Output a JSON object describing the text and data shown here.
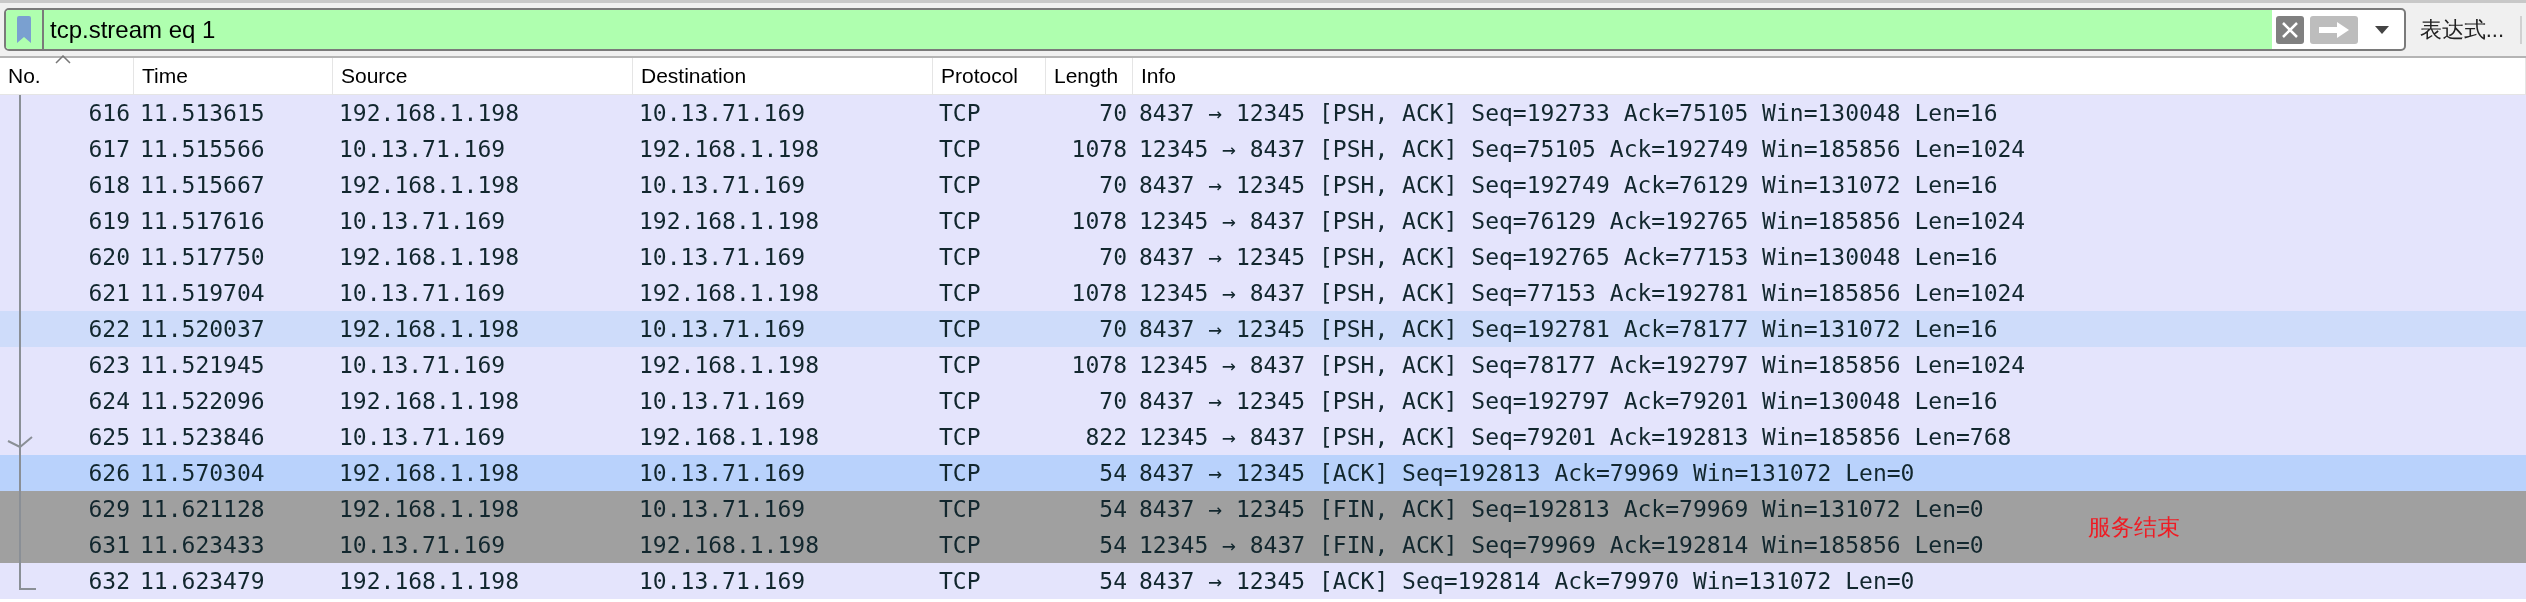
{
  "filter": {
    "value": "tcp.stream eq 1",
    "expression_button": "表达式..."
  },
  "table": {
    "columns": [
      {
        "label": "No.",
        "sorted": true
      },
      {
        "label": "Time",
        "sorted": false
      },
      {
        "label": "Source",
        "sorted": false
      },
      {
        "label": "Destination",
        "sorted": false
      },
      {
        "label": "Protocol",
        "sorted": false
      },
      {
        "label": "Length",
        "sorted": false
      },
      {
        "label": "Info",
        "sorted": false
      }
    ],
    "rows": [
      {
        "no": "616",
        "time": "11.513615",
        "source": "192.168.1.198",
        "destination": "10.13.71.169",
        "protocol": "TCP",
        "length": "70",
        "info": "8437 → 12345 [PSH, ACK] Seq=192733 Ack=75105 Win=130048 Len=16",
        "color": "#e4e4fc",
        "acked": false
      },
      {
        "no": "617",
        "time": "11.515566",
        "source": "10.13.71.169",
        "destination": "192.168.1.198",
        "protocol": "TCP",
        "length": "1078",
        "info": "12345 → 8437 [PSH, ACK] Seq=75105 Ack=192749 Win=185856 Len=1024",
        "color": "#e4e4fc",
        "acked": false
      },
      {
        "no": "618",
        "time": "11.515667",
        "source": "192.168.1.198",
        "destination": "10.13.71.169",
        "protocol": "TCP",
        "length": "70",
        "info": "8437 → 12345 [PSH, ACK] Seq=192749 Ack=76129 Win=131072 Len=16",
        "color": "#e4e4fc",
        "acked": false
      },
      {
        "no": "619",
        "time": "11.517616",
        "source": "10.13.71.169",
        "destination": "192.168.1.198",
        "protocol": "TCP",
        "length": "1078",
        "info": "12345 → 8437 [PSH, ACK] Seq=76129 Ack=192765 Win=185856 Len=1024",
        "color": "#e4e4fc",
        "acked": false
      },
      {
        "no": "620",
        "time": "11.517750",
        "source": "192.168.1.198",
        "destination": "10.13.71.169",
        "protocol": "TCP",
        "length": "70",
        "info": "8437 → 12345 [PSH, ACK] Seq=192765 Ack=77153 Win=130048 Len=16",
        "color": "#e4e4fc",
        "acked": false
      },
      {
        "no": "621",
        "time": "11.519704",
        "source": "10.13.71.169",
        "destination": "192.168.1.198",
        "protocol": "TCP",
        "length": "1078",
        "info": "12345 → 8437 [PSH, ACK] Seq=77153 Ack=192781 Win=185856 Len=1024",
        "color": "#e4e4fc",
        "acked": false
      },
      {
        "no": "622",
        "time": "11.520037",
        "source": "192.168.1.198",
        "destination": "10.13.71.169",
        "protocol": "TCP",
        "length": "70",
        "info": "8437 → 12345 [PSH, ACK] Seq=192781 Ack=78177 Win=131072 Len=16",
        "color": "#cedcfa",
        "acked": false
      },
      {
        "no": "623",
        "time": "11.521945",
        "source": "10.13.71.169",
        "destination": "192.168.1.198",
        "protocol": "TCP",
        "length": "1078",
        "info": "12345 → 8437 [PSH, ACK] Seq=78177 Ack=192797 Win=185856 Len=1024",
        "color": "#e4e4fc",
        "acked": false
      },
      {
        "no": "624",
        "time": "11.522096",
        "source": "192.168.1.198",
        "destination": "10.13.71.169",
        "protocol": "TCP",
        "length": "70",
        "info": "8437 → 12345 [PSH, ACK] Seq=192797 Ack=79201 Win=130048 Len=16",
        "color": "#e4e4fc",
        "acked": false
      },
      {
        "no": "625",
        "time": "11.523846",
        "source": "10.13.71.169",
        "destination": "192.168.1.198",
        "protocol": "TCP",
        "length": "822",
        "info": "12345 → 8437 [PSH, ACK] Seq=79201 Ack=192813 Win=185856 Len=768",
        "color": "#e4e4fc",
        "acked": true
      },
      {
        "no": "626",
        "time": "11.570304",
        "source": "192.168.1.198",
        "destination": "10.13.71.169",
        "protocol": "TCP",
        "length": "54",
        "info": "8437 → 12345 [ACK] Seq=192813 Ack=79969 Win=131072 Len=0",
        "color": "#b9d2fc",
        "acked": false
      },
      {
        "no": "629",
        "time": "11.621128",
        "source": "192.168.1.198",
        "destination": "10.13.71.169",
        "protocol": "TCP",
        "length": "54",
        "info": "8437 → 12345 [FIN, ACK] Seq=192813 Ack=79969 Win=131072 Len=0",
        "color": "#a0a0a0",
        "acked": false
      },
      {
        "no": "631",
        "time": "11.623433",
        "source": "10.13.71.169",
        "destination": "192.168.1.198",
        "protocol": "TCP",
        "length": "54",
        "info": "12345 → 8437 [FIN, ACK] Seq=79969 Ack=192814 Win=185856 Len=0",
        "color": "#a0a0a0",
        "acked": false
      },
      {
        "no": "632",
        "time": "11.623479",
        "source": "192.168.1.198",
        "destination": "10.13.71.169",
        "protocol": "TCP",
        "length": "54",
        "info": "8437 → 12345 [ACK] Seq=192814 Ack=79970 Win=131072 Len=0",
        "color": "#e4e4fc",
        "acked": false
      }
    ]
  },
  "annotation": {
    "text": "服务结束",
    "color": "#ee1c24"
  }
}
